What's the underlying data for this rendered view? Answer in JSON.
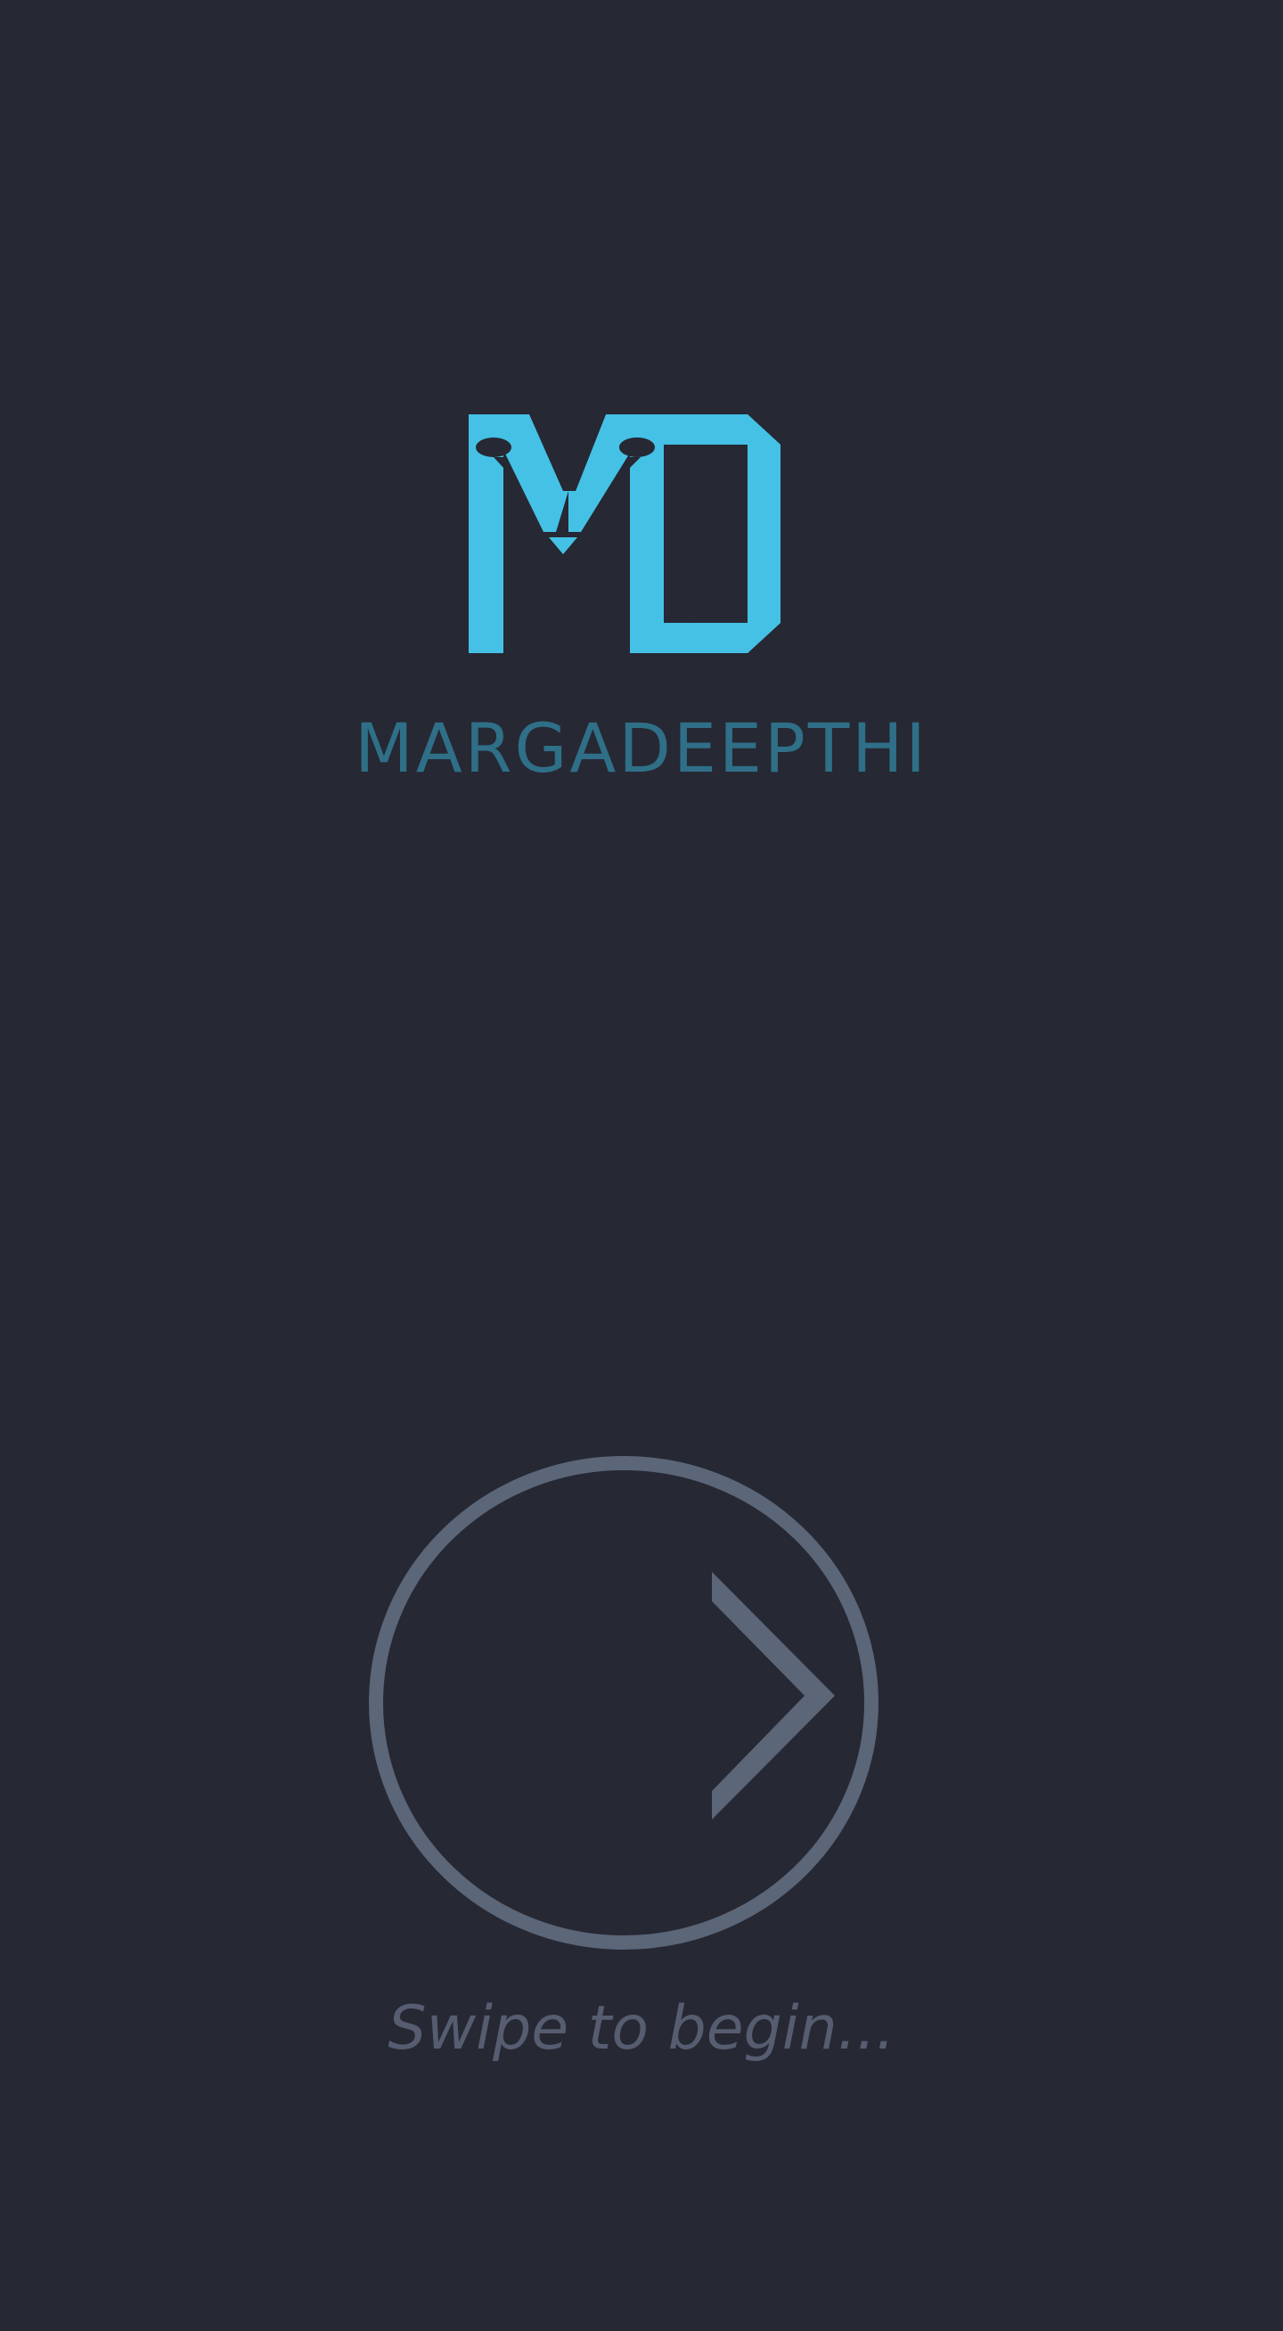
{
  "brand": {
    "logo_icon": "md-pencil-monogram-icon",
    "name": "MARGADEEPTHI",
    "logo_color": "#45c1e6",
    "name_color": "#2f6f88"
  },
  "swipe": {
    "icon": "chevron-right-icon",
    "ring_color": "#5b6678",
    "hint": "Swipe to begin..."
  },
  "colors": {
    "background": "#262833",
    "hint_text": "#575d70"
  }
}
